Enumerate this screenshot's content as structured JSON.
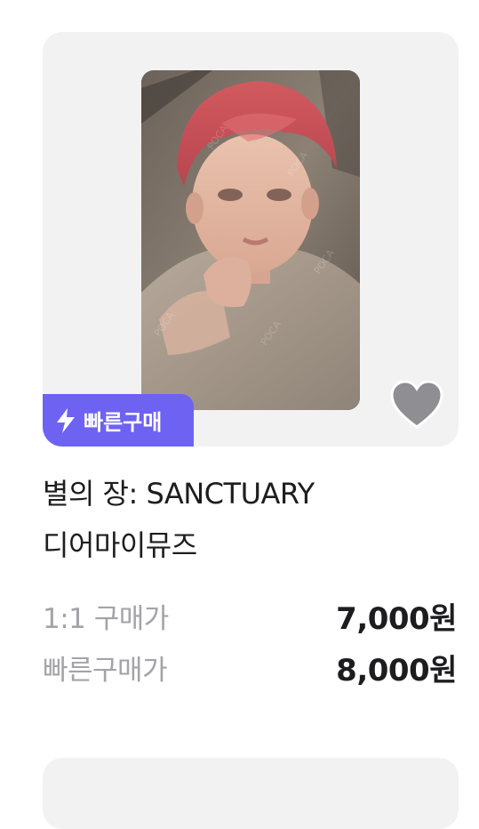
{
  "product": {
    "title": "별의 장: SANCTUARY",
    "subtitle": "디어마이뮤즈",
    "image_icon": "photocard-image",
    "watermark": "POCA 포카마켓",
    "liked": false
  },
  "badge": {
    "icon": "lightning-icon",
    "label": "빠른구매"
  },
  "favorite": {
    "icon": "heart-icon"
  },
  "prices": [
    {
      "label": "1:1 구매가",
      "value": "7,000원"
    },
    {
      "label": "빠른구매가",
      "value": "8,000원"
    }
  ],
  "colors": {
    "accent": "#6e62f2",
    "card_bg": "#f2f2f3",
    "label_gray": "#a3a3a8",
    "heart": "#8e8e93"
  }
}
